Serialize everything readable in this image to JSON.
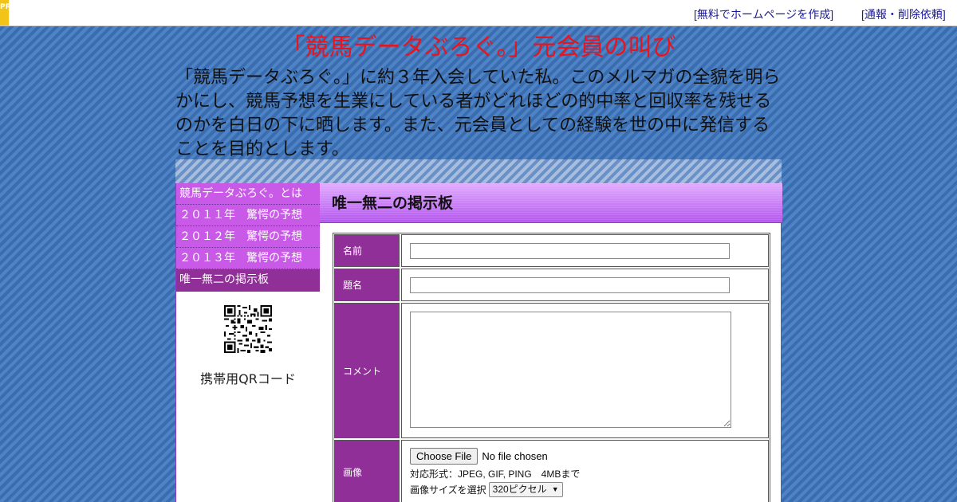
{
  "topbar": {
    "pr_label": "PR",
    "link_homepage": "[無料でホームページを作成]",
    "link_report": "[通報・削除依頼]"
  },
  "header": {
    "title": "「競馬データぶろぐ。」元会員の叫び",
    "description": "「競馬データぶろぐ。」に約３年入会していた私。このメルマガの全貌を明らかにし、競馬予想を生業にしている者がどれほどの的中率と回収率を残せるのかを白日の下に晒します。また、元会員としての経験を世の中に発信することを目的とします。"
  },
  "sidebar": {
    "items": [
      {
        "label": "競馬データぶろぐ。とは"
      },
      {
        "label": "２０１１年　驚愕の予想"
      },
      {
        "label": "２０１２年　驚愕の予想"
      },
      {
        "label": "２０１３年　驚愕の予想"
      },
      {
        "label": "唯一無二の掲示板"
      }
    ],
    "qr_label": "携帯用QRコード"
  },
  "main": {
    "heading": "唯一無二の掲示板",
    "form": {
      "name_label": "名前",
      "name_value": "",
      "subject_label": "題名",
      "subject_value": "",
      "comment_label": "コメント",
      "comment_value": "",
      "image_label": "画像",
      "file_button": "Choose File",
      "file_status": "No file chosen",
      "format_hint": "対応形式：JPEG, GIF, PING　4MBまで",
      "size_label": "画像サイズを選択",
      "size_selected": "320ピクセル"
    }
  },
  "colors": {
    "title_red": "#e8141e",
    "nav_purple": "#c95ae8",
    "nav_active": "#8f2f97",
    "label_purple": "#8f2f97",
    "background_blue": "#3f73b8"
  }
}
